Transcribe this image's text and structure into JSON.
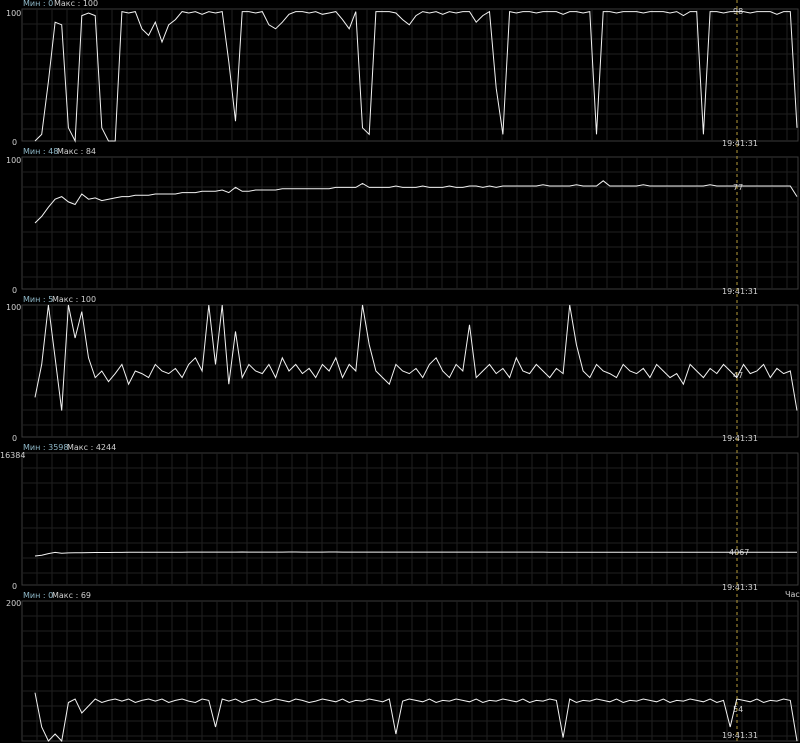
{
  "colors": {
    "background": "#000000",
    "trace": "#f2f2f2",
    "grid": "#1f1f1f",
    "min_label": "#8fb8c8",
    "cursor": "#b59a3a"
  },
  "cursor_time": "19:41:31",
  "cut_off_label": "Част",
  "chart_data": [
    {
      "type": "line",
      "min_label": "Мин : 0",
      "max_label": "Макс : 100",
      "ylim": [
        0,
        100
      ],
      "y_top_tick": "100",
      "y_bottom_tick": "0",
      "current_value": "98",
      "y": [
        0,
        5,
        45,
        90,
        88,
        10,
        0,
        95,
        97,
        95,
        10,
        0,
        0,
        98,
        97,
        98,
        85,
        80,
        90,
        75,
        88,
        92,
        98,
        97,
        98,
        96,
        98,
        97,
        98,
        60,
        15,
        98,
        98,
        97,
        98,
        88,
        85,
        90,
        96,
        98,
        98,
        97,
        98,
        96,
        97,
        98,
        92,
        85,
        98,
        10,
        5,
        98,
        98,
        98,
        97,
        92,
        88,
        95,
        98,
        97,
        98,
        96,
        98,
        97,
        98,
        98,
        90,
        95,
        98,
        40,
        5,
        98,
        97,
        98,
        98,
        97,
        98,
        98,
        98,
        96,
        98,
        98,
        97,
        98,
        5,
        98,
        98,
        97,
        98,
        98,
        98,
        97,
        98,
        98,
        98,
        97,
        98,
        95,
        98,
        98,
        5,
        98,
        98,
        97,
        98,
        98,
        98,
        97,
        98,
        98,
        98,
        96,
        98,
        98,
        10
      ]
    },
    {
      "type": "line",
      "min_label": "Мин : 48",
      "max_label": "Макс : 84",
      "ylim": [
        0,
        100
      ],
      "y_top_tick": "100",
      "y_bottom_tick": "0",
      "current_value": "77",
      "y": [
        50,
        55,
        62,
        68,
        70,
        66,
        64,
        72,
        68,
        69,
        67,
        68,
        69,
        70,
        70,
        71,
        71,
        71,
        72,
        72,
        72,
        72,
        73,
        73,
        73,
        74,
        74,
        74,
        75,
        73,
        77,
        74,
        74,
        75,
        75,
        75,
        75,
        76,
        76,
        76,
        76,
        76,
        76,
        76,
        76,
        77,
        77,
        77,
        77,
        80,
        77,
        77,
        77,
        77,
        78,
        77,
        77,
        77,
        78,
        77,
        77,
        77,
        78,
        77,
        77,
        78,
        78,
        77,
        78,
        77,
        78,
        78,
        78,
        78,
        78,
        78,
        79,
        78,
        78,
        78,
        78,
        79,
        78,
        78,
        78,
        82,
        78,
        78,
        78,
        78,
        78,
        79,
        78,
        78,
        78,
        78,
        78,
        78,
        78,
        78,
        78,
        79,
        78,
        78,
        78,
        78,
        78,
        78,
        78,
        78,
        78,
        78,
        78,
        78,
        70
      ]
    },
    {
      "type": "line",
      "min_label": "Мин : 5",
      "max_label": "Макс : 100",
      "ylim": [
        0,
        100
      ],
      "y_top_tick": "100",
      "y_bottom_tick": "0",
      "current_value": "47",
      "y": [
        30,
        55,
        100,
        60,
        20,
        100,
        75,
        95,
        60,
        45,
        50,
        42,
        48,
        55,
        40,
        50,
        48,
        45,
        55,
        50,
        48,
        52,
        45,
        55,
        60,
        50,
        100,
        55,
        100,
        40,
        80,
        45,
        55,
        50,
        48,
        55,
        45,
        60,
        50,
        55,
        48,
        52,
        45,
        55,
        50,
        60,
        45,
        55,
        50,
        100,
        70,
        50,
        45,
        40,
        55,
        50,
        48,
        52,
        45,
        55,
        60,
        50,
        45,
        55,
        50,
        85,
        45,
        50,
        55,
        48,
        52,
        45,
        60,
        50,
        48,
        55,
        50,
        45,
        52,
        48,
        100,
        70,
        50,
        45,
        55,
        50,
        48,
        45,
        55,
        50,
        48,
        52,
        45,
        55,
        50,
        45,
        48,
        40,
        55,
        50,
        45,
        52,
        48,
        55,
        50,
        45,
        55,
        48,
        50,
        55,
        45,
        52,
        48,
        50,
        20
      ]
    },
    {
      "type": "line",
      "min_label": "Мин : 3598",
      "max_label": "Макс : 4244",
      "ylim": [
        0,
        16384
      ],
      "y_top_tick": "16384",
      "y_bottom_tick": "0",
      "current_value": "4067",
      "y": [
        3598,
        3700,
        3900,
        4050,
        3950,
        3980,
        4000,
        4010,
        4020,
        4030,
        4040,
        4040,
        4050,
        4050,
        4060,
        4060,
        4060,
        4060,
        4070,
        4070,
        4070,
        4070,
        4070,
        4080,
        4080,
        4080,
        4080,
        4080,
        4080,
        4080,
        4080,
        4090,
        4080,
        4080,
        4080,
        4080,
        4080,
        4080,
        4090,
        4090,
        4080,
        4080,
        4080,
        4080,
        4090,
        4090,
        4080,
        4080,
        4080,
        4080,
        4080,
        4080,
        4080,
        4080,
        4080,
        4080,
        4080,
        4080,
        4080,
        4080,
        4080,
        4080,
        4080,
        4080,
        4080,
        4080,
        4080,
        4080,
        4080,
        4080,
        4080,
        4080,
        4080,
        4080,
        4080,
        4080,
        4080,
        4070,
        4070,
        4070,
        4070,
        4070,
        4070,
        4070,
        4070,
        4070,
        4070,
        4070,
        4070,
        4070,
        4070,
        4070,
        4070,
        4070,
        4070,
        4070,
        4070,
        4070,
        4070,
        4067,
        4067,
        4067,
        4067,
        4067,
        4067,
        4067,
        4067,
        4067,
        4067,
        4067,
        4067,
        4067,
        4067,
        4067,
        4067
      ]
    },
    {
      "type": "line",
      "min_label": "Мин : 0",
      "max_label": "Макс : 69",
      "ylim": [
        0,
        200
      ],
      "y_top_tick": "200",
      "y_bottom_tick": "0",
      "current_value": "54",
      "y": [
        69,
        20,
        0,
        10,
        0,
        55,
        60,
        40,
        50,
        60,
        55,
        58,
        60,
        57,
        60,
        55,
        58,
        60,
        57,
        60,
        55,
        58,
        60,
        57,
        55,
        60,
        58,
        20,
        60,
        57,
        60,
        55,
        58,
        60,
        55,
        57,
        60,
        58,
        56,
        60,
        58,
        55,
        57,
        60,
        58,
        56,
        60,
        55,
        58,
        57,
        60,
        58,
        56,
        60,
        10,
        57,
        60,
        58,
        56,
        60,
        55,
        58,
        57,
        60,
        58,
        56,
        60,
        55,
        58,
        57,
        60,
        58,
        56,
        60,
        55,
        58,
        57,
        60,
        58,
        5,
        60,
        55,
        58,
        57,
        60,
        58,
        56,
        60,
        55,
        58,
        57,
        60,
        58,
        56,
        60,
        55,
        58,
        57,
        60,
        58,
        56,
        60,
        55,
        58,
        20,
        60,
        58,
        56,
        60,
        55,
        58,
        57,
        60,
        58,
        0
      ]
    }
  ]
}
